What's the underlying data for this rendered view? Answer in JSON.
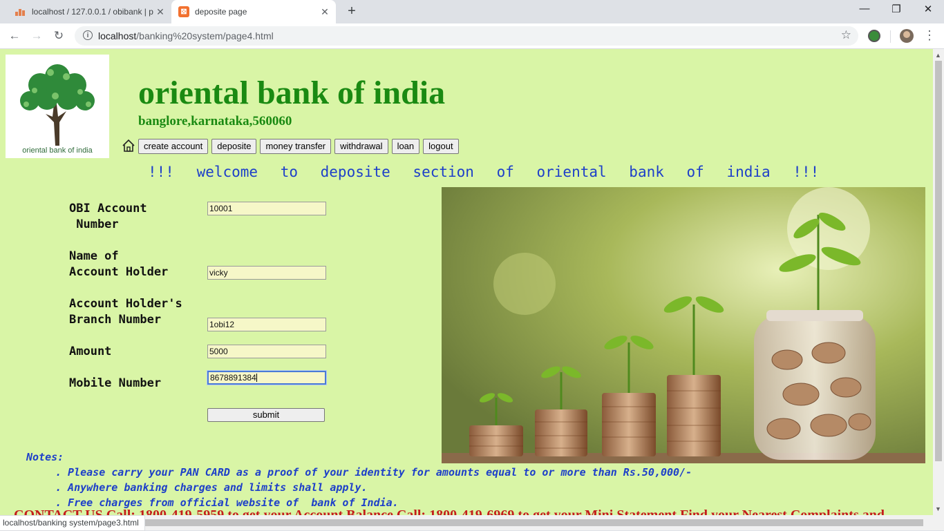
{
  "browser": {
    "tabs": [
      {
        "title": "localhost / 127.0.0.1 / obibank | p",
        "icon": "phpmyadmin-icon",
        "active": false
      },
      {
        "title": "deposite page",
        "icon": "xampp-icon",
        "active": true
      }
    ],
    "address_host": "localhost",
    "address_path": "/banking%20system/page4.html",
    "status_url": "localhost/banking system/page3.html"
  },
  "page": {
    "logo_caption": "oriental bank of india",
    "bank_name": "oriental bank of india",
    "address": "banglore,karnataka,560060",
    "nav": [
      "create account",
      "deposite",
      "money transfer",
      "withdrawal",
      "loan",
      "logout"
    ],
    "welcome": "!!! welcome to deposite section of oriental bank of india !!!",
    "form": {
      "account_label": "OBI Account\n Number",
      "account_value": "10001",
      "name_label": "Name of\nAccount Holder",
      "name_value": "vicky",
      "branch_label": "Account Holder's\nBranch Number",
      "branch_value": "1obi12",
      "amount_label": "Amount",
      "amount_value": "5000",
      "mobile_label": "Mobile Number",
      "mobile_value": "8678891384",
      "submit_label": "submit"
    },
    "notes_title": "Notes:",
    "notes": [
      ". Please carry your PAN CARD as a proof of your identity for amounts equal to or more than Rs.50,000/-",
      ". Anywhere banking charges and limits shall apply.",
      ". Free charges from official website of  bank of India."
    ],
    "marquee": "CONTACT US Call: 1800-419-5959 to get your Account Balance Call: 1800-419-6969 to get your Mini Statement Find your Nearest Complaints and"
  },
  "colors": {
    "page_bg": "#d9f5a6",
    "brand_green": "#1a8a12",
    "link_blue": "#1d3fc9",
    "marquee_red": "#c41c1c"
  }
}
